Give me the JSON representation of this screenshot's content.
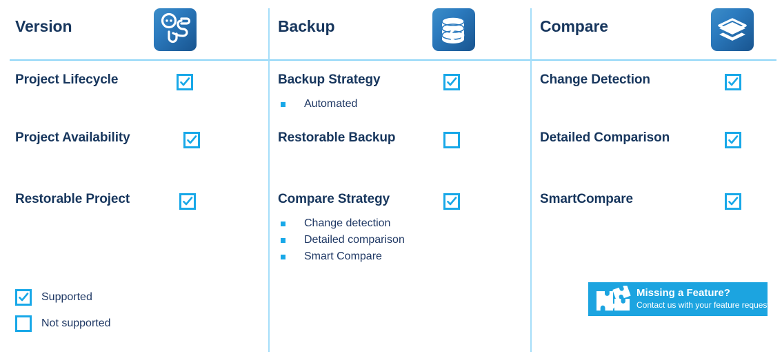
{
  "columns": [
    {
      "title": "Version",
      "icon": "version-branch-icon",
      "features": [
        {
          "label": "Project Lifecycle",
          "supported": true,
          "subitems": []
        },
        {
          "label": "Project Availability",
          "supported": true,
          "subitems": []
        },
        {
          "label": "Restorable Project",
          "supported": true,
          "subitems": []
        }
      ]
    },
    {
      "title": "Backup",
      "icon": "database-restore-icon",
      "features": [
        {
          "label": "Backup Strategy",
          "supported": true,
          "subitems": [
            "Automated"
          ]
        },
        {
          "label": "Restorable Backup",
          "supported": false,
          "subitems": []
        },
        {
          "label": "Compare Strategy",
          "supported": true,
          "subitems": [
            "Change detection",
            "Detailed comparison",
            "Smart Compare"
          ]
        }
      ]
    },
    {
      "title": "Compare",
      "icon": "layers-stack-icon",
      "features": [
        {
          "label": "Change Detection",
          "supported": true,
          "subitems": []
        },
        {
          "label": "Detailed Comparison",
          "supported": true,
          "subitems": []
        },
        {
          "label": "SmartCompare",
          "supported": true,
          "subitems": []
        }
      ]
    }
  ],
  "legend": {
    "supported_label": "Supported",
    "not_supported_label": "Not supported"
  },
  "banner": {
    "title": "Missing a Feature?",
    "subtitle": "Contact us with your feature request!",
    "icon": "puzzle-pieces-icon",
    "background_color": "#1CA4E0"
  },
  "colors": {
    "heading_navy": "#17365D",
    "accent_cyan": "#18A8E8",
    "divider_blue": "#8FD6F7",
    "icon_tile_blue": "#2C7BBF"
  }
}
